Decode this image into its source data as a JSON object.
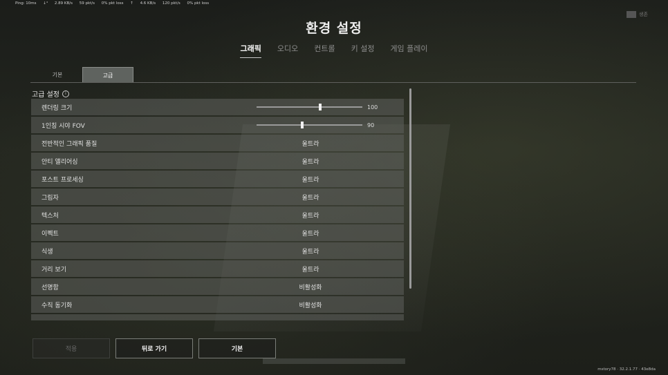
{
  "topbar": {
    "ping": "Ping: 10ms",
    "down": "2.89 KB/s",
    "down_pkts": "59 pkt/s",
    "down_loss": "0% pkt loss",
    "up": "4.6 KB/s",
    "up_pkts": "120 pkt/s",
    "up_loss": "0% pkt loss"
  },
  "top_right": {
    "label": "생존"
  },
  "title": "환경 설정",
  "main_tabs": [
    "그래픽",
    "오디오",
    "컨트롤",
    "키 설정",
    "게임 플레이"
  ],
  "sub_tabs": [
    "기본",
    "고급"
  ],
  "section": {
    "title": "고급 설정",
    "info": "i"
  },
  "sliders": [
    {
      "label": "렌더링 크기",
      "value": "100",
      "fraction": 0.6
    },
    {
      "label": "1인칭 시야 FOV",
      "value": "90",
      "fraction": 0.43
    }
  ],
  "settings": [
    {
      "label": "전반적인 그래픽 품질",
      "value": "울트라"
    },
    {
      "label": "안티 앨리어싱",
      "value": "울트라"
    },
    {
      "label": "포스트 프로세싱",
      "value": "울트라"
    },
    {
      "label": "그림자",
      "value": "울트라"
    },
    {
      "label": "텍스처",
      "value": "울트라"
    },
    {
      "label": "이펙트",
      "value": "울트라"
    },
    {
      "label": "식생",
      "value": "울트라"
    },
    {
      "label": "거리 보기",
      "value": "울트라"
    },
    {
      "label": "선명함",
      "value": "비활성화"
    },
    {
      "label": "수직 동기화",
      "value": "비활성화"
    }
  ],
  "buttons": {
    "apply": "적용",
    "back": "뒤로 가기",
    "default": "기본"
  },
  "version": "mstory78 · 32.2.1.77 · 43e8da"
}
